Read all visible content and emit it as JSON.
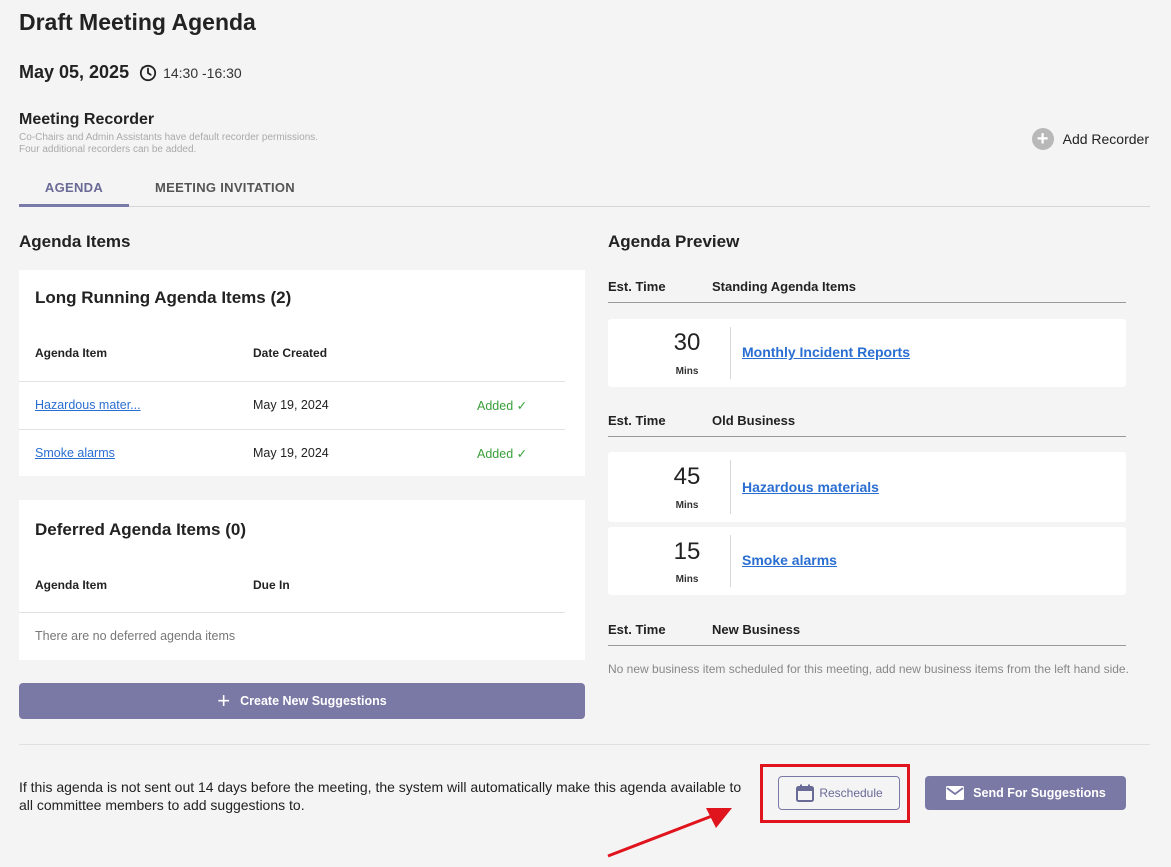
{
  "page": {
    "title": "Draft Meeting Agenda",
    "date": "May 05, 2025",
    "time": "14:30 -16:30"
  },
  "recorder": {
    "title": "Meeting Recorder",
    "description": "Co-Chairs and Admin Assistants have default recorder permissions. Four additional recorders can be added.",
    "add_label": "Add Recorder"
  },
  "tabs": [
    {
      "label": "AGENDA",
      "active": true
    },
    {
      "label": "MEETING INVITATION",
      "active": false
    }
  ],
  "agenda_items": {
    "title": "Agenda Items",
    "long_running": {
      "title": "Long Running Agenda Items (2)",
      "col_item": "Agenda Item",
      "col_date": "Date Created",
      "rows": [
        {
          "item": "Hazardous mater...",
          "date": "May 19, 2024",
          "status": "Added ✓"
        },
        {
          "item": "Smoke alarms",
          "date": "May 19, 2024",
          "status": "Added ✓"
        }
      ]
    },
    "deferred": {
      "title": "Deferred Agenda Items (0)",
      "col_item": "Agenda Item",
      "col_due": "Due In",
      "empty": "There are no deferred agenda items"
    },
    "create_label": "Create New Suggestions"
  },
  "preview": {
    "title": "Agenda Preview",
    "est_label": "Est. Time",
    "sections": [
      {
        "category": "Standing Agenda Items",
        "items": [
          {
            "mins": "30",
            "unit": "Mins",
            "name": "Monthly Incident Reports"
          }
        ]
      },
      {
        "category": "Old Business",
        "items": [
          {
            "mins": "45",
            "unit": "Mins",
            "name": "Hazardous materials"
          },
          {
            "mins": "15",
            "unit": "Mins",
            "name": "Smoke alarms"
          }
        ]
      },
      {
        "category": "New Business",
        "items": []
      }
    ],
    "no_new_business": "No new business item scheduled for this meeting, add new business items from the left hand side."
  },
  "footer": {
    "note": "If this agenda is not sent out 14 days before the meeting, the system will automatically make this agenda available to all committee members to add suggestions to.",
    "reschedule_label": "Reschedule",
    "send_label": "Send For Suggestions"
  },
  "colors": {
    "accent": "#7a79a6",
    "link": "#2a6ed2",
    "added": "#3aa03a",
    "highlight": "#e0141c"
  }
}
